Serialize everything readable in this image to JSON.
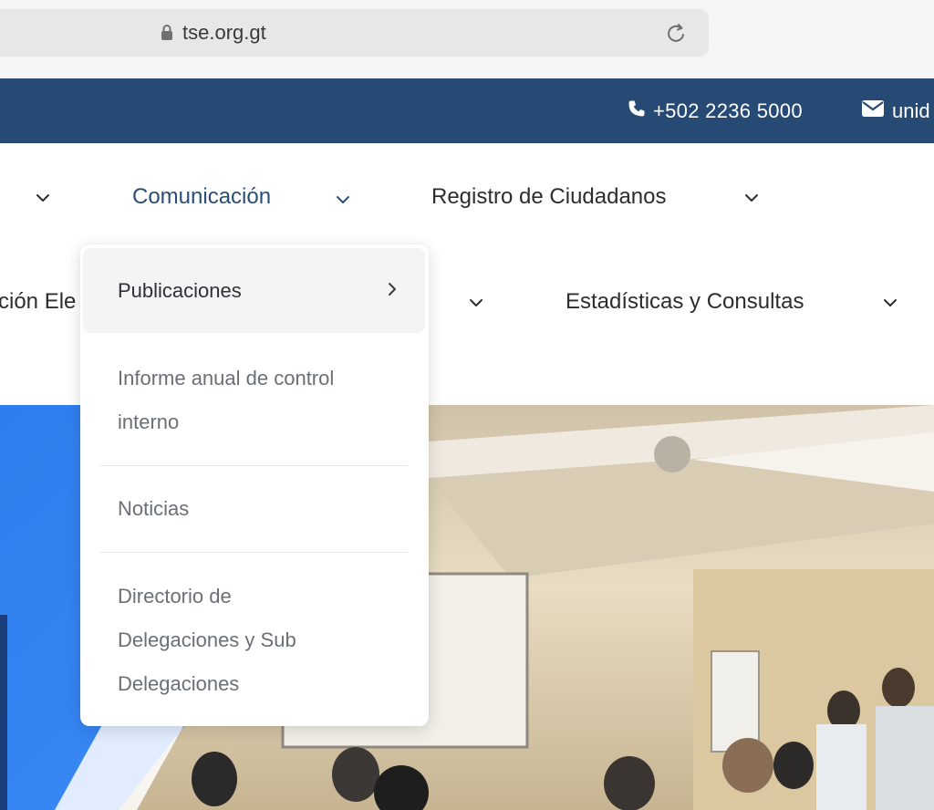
{
  "browser": {
    "url": "tse.org.gt",
    "icons": {
      "lock": "lock-icon",
      "reload": "reload-icon"
    }
  },
  "topbar": {
    "phone": "+502 2236 5000",
    "email": "unid",
    "background": "#264a73"
  },
  "nav": {
    "row1": [
      {
        "label": "",
        "has_chevron": true
      },
      {
        "label": "Comunicación",
        "has_chevron": true,
        "active": true
      },
      {
        "label": "Registro de Ciudadanos",
        "has_chevron": true
      }
    ],
    "row2": [
      {
        "label": "ción Ele",
        "has_chevron": false
      },
      {
        "label": "",
        "has_chevron": true
      },
      {
        "label": "Estadísticas y Consultas",
        "has_chevron": true
      }
    ],
    "accent": "#2a4e78"
  },
  "dropdown": {
    "items": [
      {
        "label": "Publicaciones",
        "has_submenu": true,
        "highlighted": true
      },
      {
        "line1": "Informe anual de control",
        "line2": "interno"
      },
      {
        "label": "Noticias"
      },
      {
        "line1": "Directorio de",
        "line2": "Delegaciones y Sub",
        "line3": "Delegaciones"
      }
    ]
  }
}
